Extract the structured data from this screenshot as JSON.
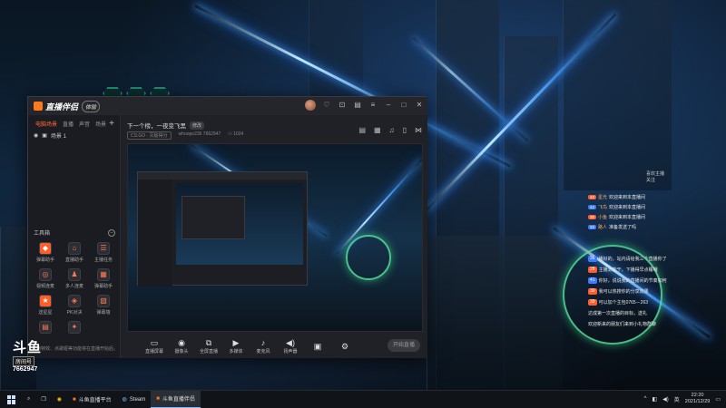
{
  "app": {
    "brand": "直播伴侣",
    "version_badge": "体验"
  },
  "left_panel": {
    "tabs": [
      "电脑场景",
      "直播",
      "声音",
      "场景"
    ],
    "scene": "场景 1",
    "tools_title": "工具箱",
    "tools": [
      {
        "label": "弹幕助手",
        "icon": "danmaku-icon"
      },
      {
        "label": "直播助手",
        "icon": "assistant-icon"
      },
      {
        "label": "主播任务",
        "icon": "task-icon"
      },
      {
        "label": "视频连麦",
        "icon": "video-link-icon"
      },
      {
        "label": "多人连麦",
        "icon": "multi-link-icon"
      },
      {
        "label": "弹幕助手",
        "icon": "chat-icon"
      },
      {
        "label": "送星星",
        "icon": "star-icon"
      },
      {
        "label": "PK对决",
        "icon": "pk-icon"
      },
      {
        "label": "弹幕墙",
        "icon": "wall-icon"
      },
      {
        "label": "",
        "icon": "more-icon"
      },
      {
        "label": "",
        "icon": "extra-icon"
      }
    ],
    "notice": "礼物特效、点歌姬等功能将在直播开始后，敬请期待"
  },
  "stream": {
    "title": "下一个榜，一夜变飞黑",
    "edit_label": "修改",
    "category": "CS:GO · 灭敌得分",
    "room_id": "whoopo236 7662947",
    "viewers": "1024"
  },
  "toolbar": [
    {
      "label": "直播屏幕",
      "icon": "screen-icon"
    },
    {
      "label": "摄像头",
      "icon": "camera-icon"
    },
    {
      "label": "全屏直播",
      "icon": "fullscreen-icon"
    },
    {
      "label": "多媒体",
      "icon": "media-icon"
    },
    {
      "label": "麦克风",
      "icon": "mic-icon"
    },
    {
      "label": "扬声器",
      "icon": "speaker-icon"
    }
  ],
  "start_button": "开始直播",
  "chat_top": [
    {
      "level": "40",
      "nick": "星光",
      "text": "欢迎来到本直播间"
    },
    {
      "level": "42",
      "nick": "飞鸟",
      "text": "欢迎来到本直播间"
    },
    {
      "level": "38",
      "nick": "小鱼",
      "text": "欢迎来到本直播间"
    },
    {
      "level": "33",
      "nick": "路人",
      "text": "准备发送了吗"
    }
  ],
  "chat_bottom": [
    {
      "level": "36",
      "text": "播好的，站内请给我三个直播你了"
    },
    {
      "level": "28",
      "text": "主播太能干，下播得早点睡哦"
    },
    {
      "level": "41",
      "text": "你好，说说我的直播间的节奏如何"
    },
    {
      "level": "30",
      "text": "我可以热搜你的分享效果"
    },
    {
      "level": "39",
      "text": "可以加个主包0765－263"
    },
    {
      "level": "",
      "text": "达成第一次直播的目标，送礼"
    },
    {
      "level": "",
      "text": "欢迎新来的朋友们来到小礼物群聊"
    }
  ],
  "side_info": {
    "line1": "喜欢主播",
    "line2": "关注"
  },
  "douyu": {
    "logo_text": "斗鱼",
    "plate": "房间号",
    "room_number": "7662947"
  },
  "taskbar": {
    "items": [
      {
        "label": "",
        "icon": "search-icon"
      },
      {
        "label": "",
        "icon": "taskview-icon"
      },
      {
        "label": "",
        "icon": "chrome-icon"
      },
      {
        "label": "斗鱼直播平台",
        "icon": "app-icon"
      },
      {
        "label": "Steam",
        "icon": "steam-icon"
      },
      {
        "label": "斗鱼直播伴侣",
        "icon": "douyu-icon"
      }
    ],
    "time": "22:20",
    "date": "2021/12/29",
    "lang": "英"
  }
}
